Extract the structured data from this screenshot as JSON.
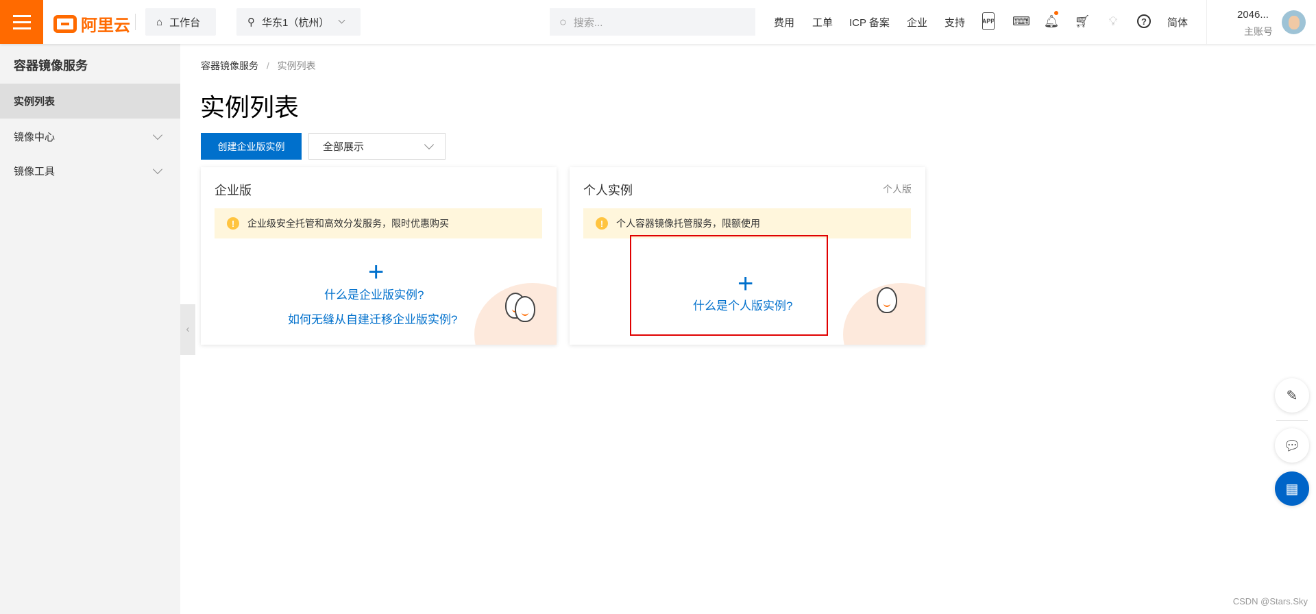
{
  "header": {
    "logo": "阿里云",
    "workbench": "工作台",
    "region": "华东1（杭州）",
    "search_placeholder": "搜索...",
    "nav": [
      "费用",
      "工单",
      "ICP 备案",
      "企业",
      "支持"
    ],
    "icon_app": "APP",
    "lang": "简体",
    "user_name": "2046...",
    "account_type": "主账号"
  },
  "sidebar": {
    "title": "容器镜像服务",
    "items": [
      {
        "label": "实例列表"
      },
      {
        "label": "镜像中心"
      },
      {
        "label": "镜像工具"
      }
    ]
  },
  "main": {
    "breadcrumb": [
      "容器镜像服务",
      "实例列表"
    ],
    "title": "实例列表",
    "create_button": "创建企业版实例",
    "filter_value": "全部展示",
    "cards": [
      {
        "title": "企业版",
        "alert": "企业级安全托管和高效分发服务，限时优惠购买",
        "links": [
          "什么是企业版实例?",
          "如何无缝从自建迁移企业版实例?"
        ]
      },
      {
        "title": "个人实例",
        "tag": "个人版",
        "alert": "个人容器镜像托管服务，限额使用",
        "links": [
          "什么是个人版实例?"
        ]
      }
    ]
  },
  "watermark": "CSDN @Stars.Sky",
  "colors": {
    "brand": "#ff6a00",
    "primary": "#0070cc",
    "highlight": "#e00000"
  }
}
